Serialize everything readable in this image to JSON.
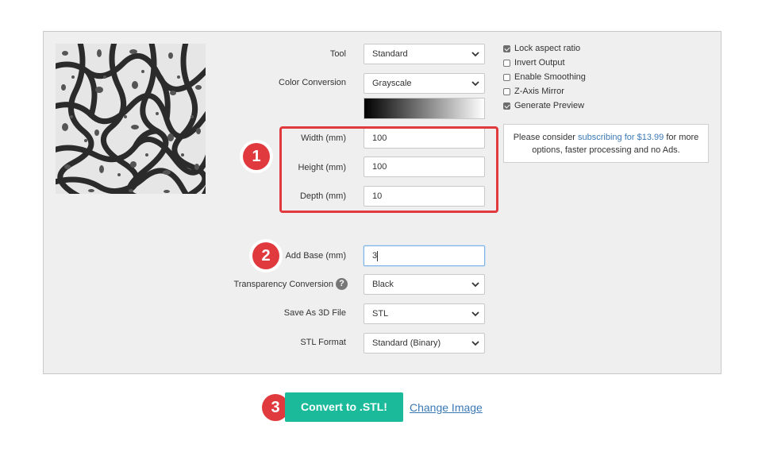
{
  "form": {
    "tool": {
      "label": "Tool",
      "value": "Standard"
    },
    "color_conversion": {
      "label": "Color Conversion",
      "value": "Grayscale"
    },
    "width": {
      "label": "Width (mm)",
      "value": "100"
    },
    "height": {
      "label": "Height (mm)",
      "value": "100"
    },
    "depth": {
      "label": "Depth (mm)",
      "value": "10"
    },
    "add_base": {
      "label": "Add Base (mm)",
      "value": "3"
    },
    "transparency": {
      "label": "Transparency Conversion",
      "value": "Black",
      "help_icon": "?"
    },
    "save_as": {
      "label": "Save As 3D File",
      "value": "STL"
    },
    "stl_format": {
      "label": "STL Format",
      "value": "Standard (Binary)"
    }
  },
  "options": [
    {
      "label": "Lock aspect ratio",
      "checked": true
    },
    {
      "label": "Invert Output",
      "checked": false
    },
    {
      "label": "Enable Smoothing",
      "checked": false
    },
    {
      "label": "Z-Axis Mirror",
      "checked": false
    },
    {
      "label": "Generate Preview",
      "checked": true
    }
  ],
  "promo": {
    "prefix": "Please consider ",
    "link": "subscribing for $13.99",
    "suffix": " for more options, faster processing and no Ads."
  },
  "badges": [
    "1",
    "2",
    "3"
  ],
  "actions": {
    "convert_label": "Convert to .STL!",
    "change_image_label": "Change Image"
  },
  "colors": {
    "accent": "#1aba9a",
    "highlight": "#e03a3e",
    "link": "#3b79b5"
  },
  "icons": [
    "chevron-down-icon",
    "question-icon",
    "checkbox-icon"
  ]
}
